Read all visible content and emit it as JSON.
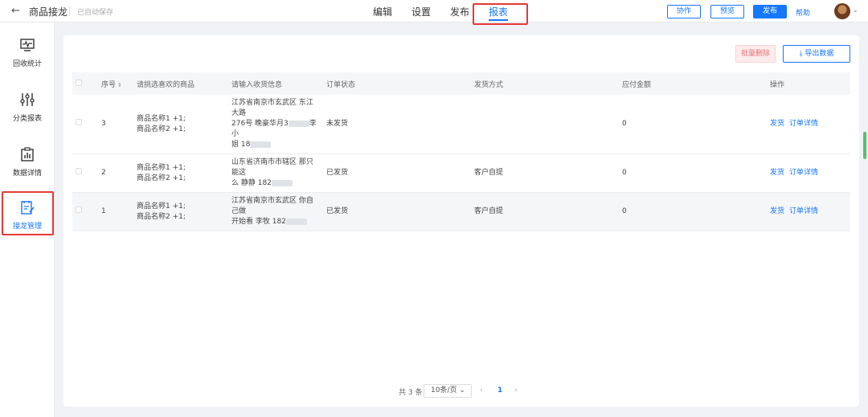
{
  "header": {
    "back_icon": "←",
    "title": "商品接龙",
    "autosave": "已自动保存",
    "tabs": [
      "编辑",
      "设置",
      "发布",
      "报表"
    ],
    "active_tab": "报表",
    "buttons": {
      "collab": "协作",
      "preview": "预览",
      "publish": "发布",
      "help": "帮助"
    },
    "caret": "⌄"
  },
  "sidebar": {
    "items": [
      {
        "label": "回收统计",
        "icon": "monitor-icon"
      },
      {
        "label": "分类报表",
        "icon": "sliders-icon"
      },
      {
        "label": "数据详情",
        "icon": "clipboard-chart-icon"
      },
      {
        "label": "接龙管理",
        "icon": "edit-list-icon"
      }
    ],
    "active": "接龙管理"
  },
  "toolbar": {
    "bulk_delete": "批量删除",
    "export": "导出数据",
    "export_icon": "⤓"
  },
  "table": {
    "columns": [
      "序号",
      "请挑选喜欢的商品",
      "请输入收货信息",
      "订单状态",
      "发货方式",
      "应付金额",
      "操作"
    ],
    "sort_icon": "⇕",
    "rows": [
      {
        "no": "3",
        "goods1": "商品名称1 +1;",
        "goods2": "商品名称2 +1;",
        "addr1": "江苏省南京市玄武区 东江大路",
        "addr2": "276号 晚豪华月3",
        "addr3": "李小",
        "addr4": "姐 18",
        "status": "未发货",
        "ship": "",
        "amount": "0",
        "op1": "发货",
        "op2": "订单详情"
      },
      {
        "no": "2",
        "goods1": "商品名称1 +1;",
        "goods2": "商品名称2 +1;",
        "addr1": "山东省济南市市辖区 那只能这",
        "addr2": "么 静静 182",
        "addr3": "",
        "addr4": "",
        "status": "已发货",
        "ship": "客户自提",
        "amount": "0",
        "op1": "发货",
        "op2": "订单详情"
      },
      {
        "no": "1",
        "goods1": "商品名称1 +1;",
        "goods2": "商品名称2 +1;",
        "addr1": "江苏省南京市玄武区 你自己做",
        "addr2": "开始看 李牧 182",
        "addr3": "",
        "addr4": "",
        "status": "已发货",
        "ship": "客户自提",
        "amount": "0",
        "op1": "发货",
        "op2": "订单详情"
      }
    ]
  },
  "pagination": {
    "total": "共 3 条",
    "page_size": "10条/页",
    "page_size_caret": "⌄",
    "prev": "‹",
    "current": "1",
    "next": "›"
  }
}
